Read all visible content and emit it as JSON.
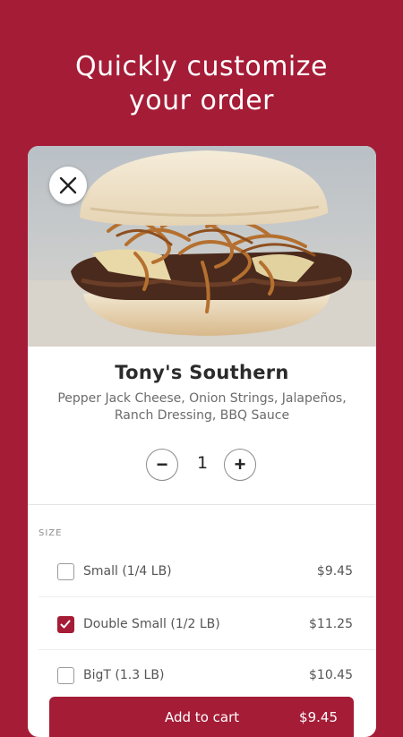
{
  "headline": {
    "line1": "Quickly customize",
    "line2": "your order"
  },
  "product": {
    "name": "Tony's Southern",
    "description": "Pepper Jack Cheese, Onion Strings, Jalapeños, Ranch Dressing, BBQ Sauce",
    "image_icon": "burger-photo"
  },
  "quantity": {
    "minus": "−",
    "value": "1",
    "plus": "+"
  },
  "size_section": {
    "label": "SIZE",
    "options": [
      {
        "label": "Small (1/4 LB)",
        "price": "$9.45",
        "checked": false
      },
      {
        "label": "Double Small (1/2 LB)",
        "price": "$11.25",
        "checked": true
      },
      {
        "label": "BigT (1.3 LB)",
        "price": "$10.45",
        "checked": false
      }
    ]
  },
  "cart": {
    "label": "Add to cart",
    "price": "$9.45"
  },
  "colors": {
    "brand": "#a51c36",
    "card": "#ffffff",
    "text": "#2b2b2b"
  }
}
